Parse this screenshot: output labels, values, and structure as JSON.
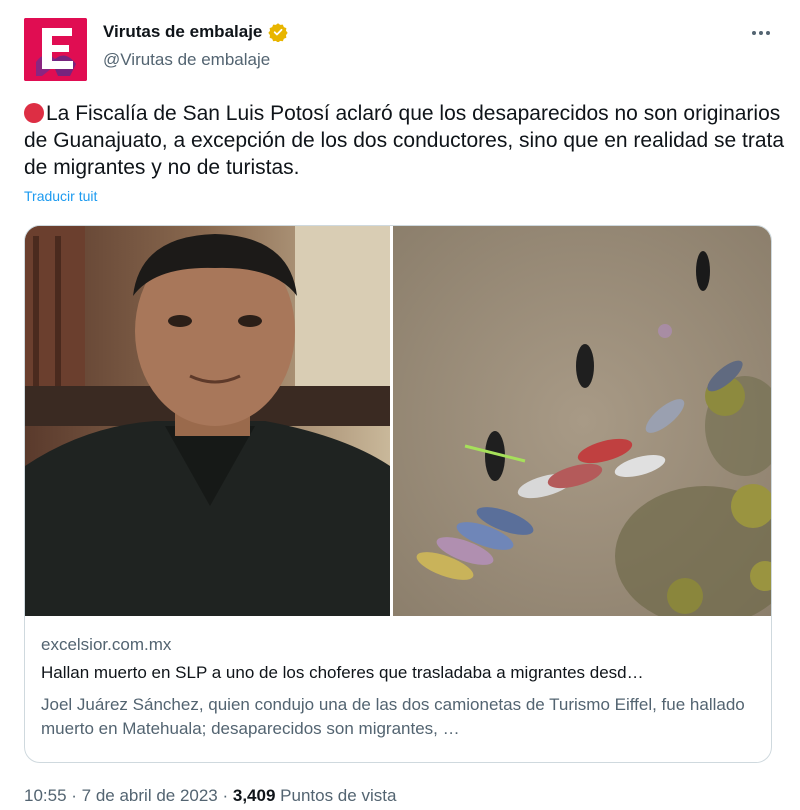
{
  "author": {
    "display_name": "Virutas de embalaje",
    "handle": "@Virutas de embalaje",
    "avatar_letter": "E",
    "avatar_color": "#e00d52",
    "verified": true,
    "verified_color": "#e8b500"
  },
  "tweet": {
    "emoji": "red-circle",
    "text": "La Fiscalía de San Luis Potosí aclaró que los desaparecidos no son originarios de Guanajuato, a excepción de los dos conductores, sino que en realidad se trata de migrantes y no de turistas.",
    "translate_label": "Traducir tuit"
  },
  "card": {
    "domain": "excelsior.com.mx",
    "title": "Hallan muerto en SLP a uno de los choferes que trasladaba a migrantes desd…",
    "description": "Joel Juárez Sánchez, quien condujo una de las dos camionetas de Turismo Eiffel, fue hallado muerto en Matehuala; desaparecidos son migrantes, …"
  },
  "meta": {
    "time": "10:55",
    "separator": " · ",
    "date": "7 de abril de 2023",
    "views": "3,409",
    "views_label": "Puntos de vista"
  },
  "colors": {
    "text": "#0f1419",
    "secondary": "#536471",
    "link": "#1d9bf0",
    "border": "#cfd9de"
  }
}
